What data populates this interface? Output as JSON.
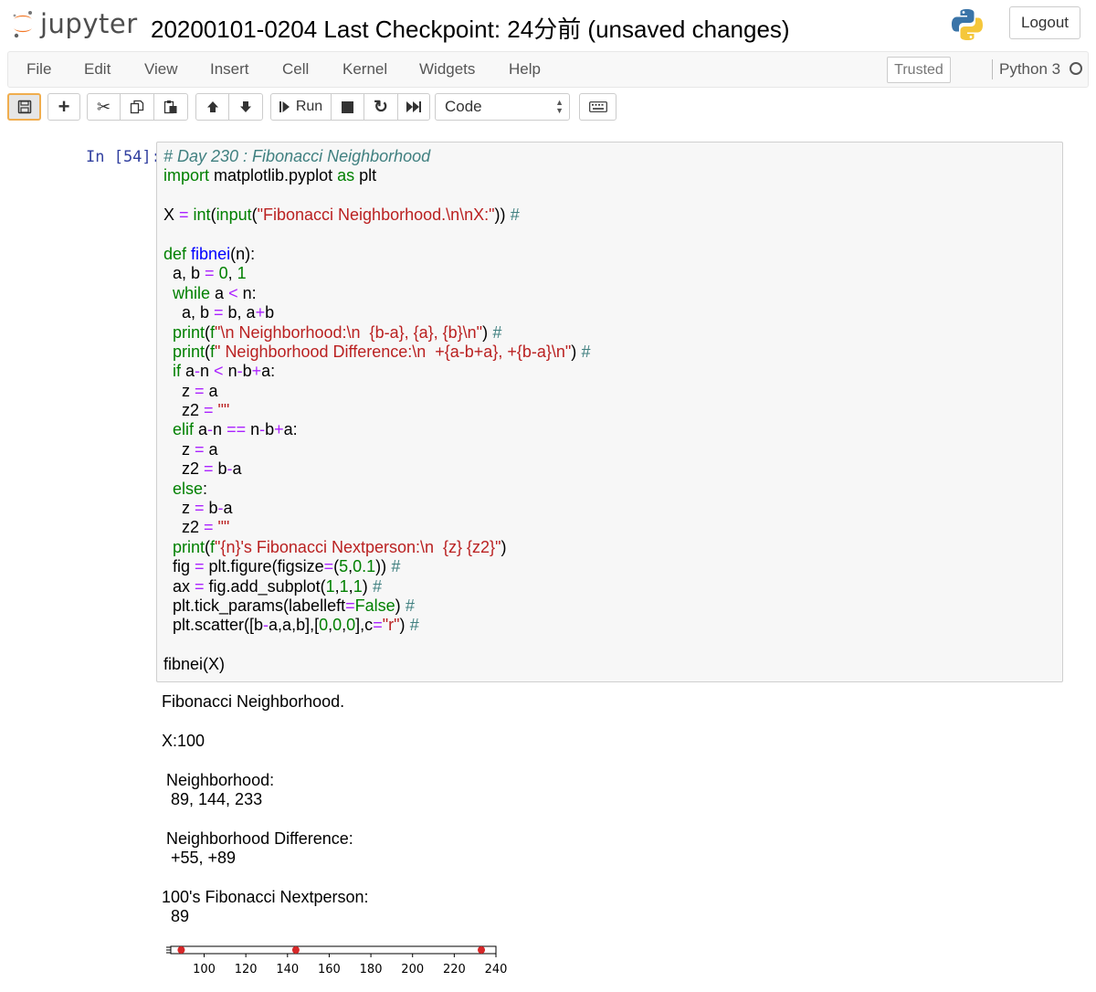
{
  "header": {
    "logo_text": "jupyter",
    "notebook_title": "20200101-0204 Last Checkpoint: 24分前  (unsaved changes)",
    "logout_label": "Logout"
  },
  "menubar": {
    "items": [
      "File",
      "Edit",
      "View",
      "Insert",
      "Cell",
      "Kernel",
      "Widgets",
      "Help"
    ],
    "trusted_label": "Trusted",
    "kernel_name": "Python 3"
  },
  "toolbar": {
    "run_label": "Run",
    "cell_type": "Code",
    "buttons": [
      "save-icon",
      "plus-icon",
      "scissors-icon",
      "copy-icon",
      "paste-icon",
      "arrow-up-icon",
      "arrow-down-icon",
      "run-icon",
      "stop-icon",
      "restart-icon",
      "fast-forward-icon",
      "keyboard-icon"
    ]
  },
  "cell": {
    "prompt": "In [54]:",
    "code_lines": [
      "# Day 230 : Fibonacci Neighborhood",
      "import matplotlib.pyplot as plt",
      "",
      "X = int(input(\"Fibonacci Neighborhood.\\n\\nX:\")) #",
      "",
      "def fibnei(n):",
      "    a, b = 0, 1",
      "    while a < n:",
      "        a, b = b, a+b",
      "    print(f\"\\n Neighborhood:\\n  {b-a}, {a}, {b}\\n\") #",
      "    print(f\" Neighborhood Difference:\\n  +{a-b+a}, +{b-a}\\n\") #",
      "    if a-n < n-b+a:",
      "        z = a",
      "        z2 = \"\"",
      "    elif a-n == n-b+a:",
      "        z = a",
      "        z2 = b-a",
      "    else:",
      "        z = b-a",
      "        z2 = \"\"",
      "    print(f\"{n}'s Fibonacci Nextperson:\\n  {z} {z2}\")",
      "    fig = plt.figure(figsize=(5,0.1)) #",
      "    ax = fig.add_subplot(1,1,1) #",
      "    plt.tick_params(labelleft=False) #",
      "    plt.scatter([b-a,a,b],[0,0,0],c=\"r\") #",
      "",
      "fibnei(X)"
    ]
  },
  "output": {
    "lines": [
      "Fibonacci Neighborhood.",
      "",
      "X:100",
      "",
      " Neighborhood:",
      "  89, 144, 233",
      "",
      " Neighborhood Difference:",
      "  +55, +89",
      "",
      "100's Fibonacci Nextperson:",
      "  89"
    ]
  },
  "chart_data": {
    "type": "scatter",
    "x": [
      89,
      144,
      233
    ],
    "y": [
      0,
      0,
      0
    ],
    "xlim": [
      84,
      240
    ],
    "xticks": [
      100,
      120,
      140,
      160,
      180,
      200,
      220,
      240
    ],
    "color": "#d62728"
  },
  "colors": {
    "prompt": "#303f9f",
    "comment": "#408080",
    "keyword": "#008000",
    "string": "#ba2121",
    "operator": "#aa22ff",
    "function": "#0000ff",
    "save_border": "#f0ad4e"
  }
}
